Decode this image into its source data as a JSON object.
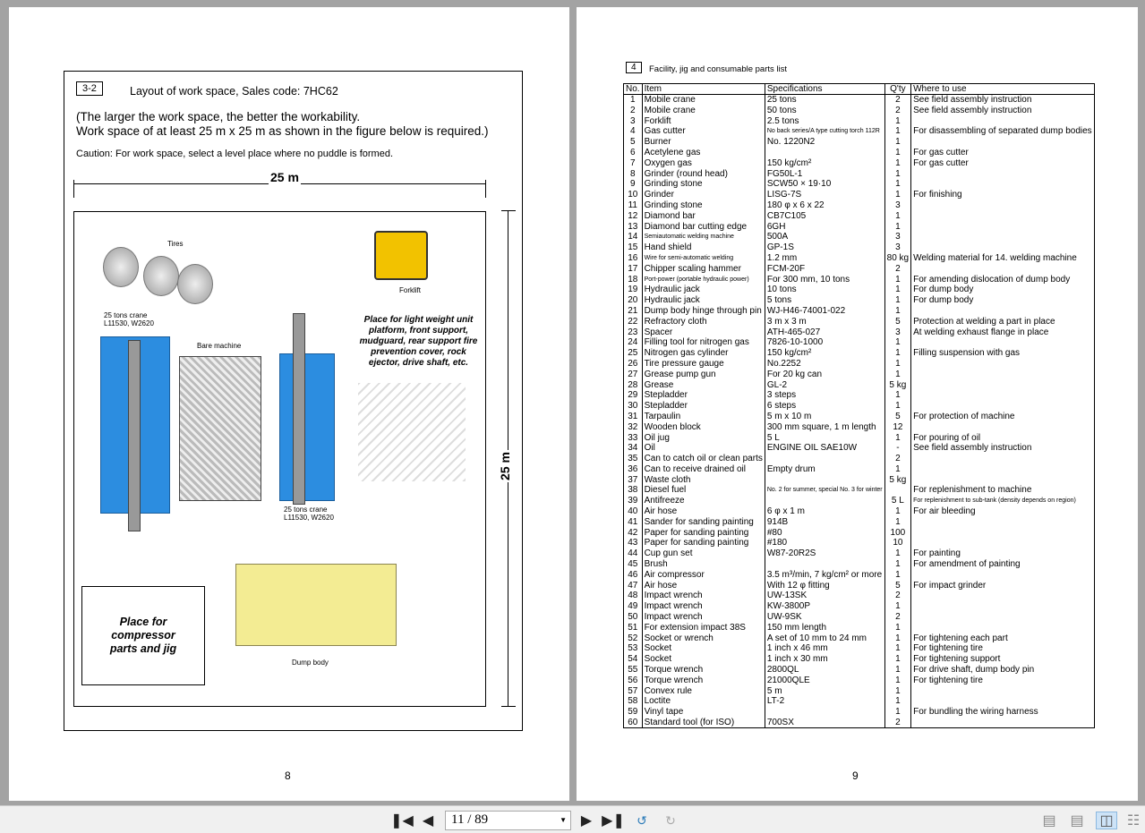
{
  "left_page": {
    "section_no": "3-2",
    "section_title": "Layout of work space, Sales code: 7HC62",
    "intro_1": "(The larger the work space, the better the workability.",
    "intro_2": "Work space of at least 25 m x 25 m as shown in the figure below is required.)",
    "caution": "Caution: For work space, select a level place where no puddle is formed.",
    "dim_horizontal": "25 m",
    "dim_vertical": "25 m",
    "labels": {
      "tires": "Tires",
      "forklift": "Forklift",
      "crane_left": "25 tons crane\nL11530, W2620",
      "bare_machine": "Bare machine",
      "crane_right": "25 tons crane\nL11530, W2620",
      "light_parts": "Place for light weight unit platform, front support, mudguard, rear support fire prevention cover, rock ejector, drive shaft, etc.",
      "compressor": "Place for compressor parts and jig",
      "dump_body": "Dump body"
    },
    "page_number": "8"
  },
  "right_page": {
    "section_no": "4",
    "section_title": "Facility, jig and consumable parts list",
    "headers": [
      "No.",
      "Item",
      "Specifications",
      "Q'ty",
      "Where to use"
    ],
    "rows": [
      [
        "1",
        "Mobile crane",
        "25 tons",
        "2",
        "See field assembly instruction"
      ],
      [
        "2",
        "Mobile crane",
        "50 tons",
        "2",
        "See field assembly instruction"
      ],
      [
        "3",
        "Forklift",
        "2.5 tons",
        "1",
        ""
      ],
      [
        "4",
        "Gas cutter",
        "No back series/A type cutting torch 112R",
        "1",
        "For disassembling of separated dump bodies"
      ],
      [
        "5",
        "Burner",
        "No. 1220N2",
        "1",
        ""
      ],
      [
        "6",
        "Acetylene gas",
        "",
        "1",
        "For gas cutter"
      ],
      [
        "7",
        "Oxygen gas",
        "150 kg/cm²",
        "1",
        "For gas cutter"
      ],
      [
        "8",
        "Grinder (round head)",
        "FG50L-1",
        "1",
        ""
      ],
      [
        "9",
        "Grinding stone",
        "SCW50 × 19·10",
        "1",
        ""
      ],
      [
        "10",
        "Grinder",
        "LISG-7S",
        "1",
        "For finishing"
      ],
      [
        "11",
        "Grinding stone",
        "180 φ x 6 x 22",
        "3",
        ""
      ],
      [
        "12",
        "Diamond bar",
        "CB7C105",
        "1",
        ""
      ],
      [
        "13",
        "Diamond bar cutting edge",
        "6GH",
        "1",
        ""
      ],
      [
        "14",
        "Semiautomatic welding machine",
        "500A",
        "3",
        ""
      ],
      [
        "15",
        "Hand shield",
        "GP-1S",
        "3",
        ""
      ],
      [
        "16",
        "Wire for semi-automatic welding",
        "1.2 mm",
        "80 kg",
        "Welding material for 14. welding machine"
      ],
      [
        "17",
        "Chipper scaling hammer",
        "FCM-20F",
        "2",
        ""
      ],
      [
        "18",
        "Port-power (portable hydraulic power)",
        "For 300 mm, 10 tons",
        "1",
        "For amending dislocation of dump body"
      ],
      [
        "19",
        "Hydraulic jack",
        "10 tons",
        "1",
        "For dump body"
      ],
      [
        "20",
        "Hydraulic jack",
        "5 tons",
        "1",
        "For dump body"
      ],
      [
        "21",
        "Dump body hinge through pin",
        "WJ-H46-74001-022",
        "1",
        ""
      ],
      [
        "22",
        "Refractory cloth",
        "3 m x 3 m",
        "5",
        "Protection at welding a part in place"
      ],
      [
        "23",
        "Spacer",
        "ATH-465-027",
        "3",
        "At welding exhaust flange in place"
      ],
      [
        "24",
        "Filling tool for nitrogen gas",
        "7826-10-1000",
        "1",
        ""
      ],
      [
        "25",
        "Nitrogen gas cylinder",
        "150 kg/cm²",
        "1",
        "Filling suspension with gas"
      ],
      [
        "26",
        "Tire pressure gauge",
        "No.2252",
        "1",
        ""
      ],
      [
        "27",
        "Grease pump gun",
        "For 20 kg can",
        "1",
        ""
      ],
      [
        "28",
        "Grease",
        "GL-2",
        "5 kg",
        ""
      ],
      [
        "29",
        "Stepladder",
        "3 steps",
        "1",
        ""
      ],
      [
        "30",
        "Stepladder",
        "6 steps",
        "1",
        ""
      ],
      [
        "31",
        "Tarpaulin",
        "5 m x 10 m",
        "5",
        "For protection of machine"
      ],
      [
        "32",
        "Wooden block",
        "300 mm square, 1 m length",
        "12",
        ""
      ],
      [
        "33",
        "Oil jug",
        "5 L",
        "1",
        "For pouring of oil"
      ],
      [
        "34",
        "Oil",
        "ENGINE OIL SAE10W",
        "-",
        "See field assembly instruction"
      ],
      [
        "35",
        "Can to catch oil or clean parts",
        "",
        "2",
        ""
      ],
      [
        "36",
        "Can to receive drained oil",
        "Empty drum",
        "1",
        ""
      ],
      [
        "37",
        "Waste cloth",
        "",
        "5 kg",
        ""
      ],
      [
        "38",
        "Diesel fuel",
        "No. 2 for summer, special No. 3 for winter",
        "",
        "For replenishment to machine"
      ],
      [
        "39",
        "Antifreeze",
        "",
        "5 L",
        "For replenishment to sub-tank (density depends on region)"
      ],
      [
        "40",
        "Air hose",
        "6 φ x 1 m",
        "1",
        "For air bleeding"
      ],
      [
        "41",
        "Sander for sanding painting",
        "914B",
        "1",
        ""
      ],
      [
        "42",
        "Paper for sanding painting",
        "#80",
        "100",
        ""
      ],
      [
        "43",
        "Paper for sanding painting",
        "#180",
        "10",
        ""
      ],
      [
        "44",
        "Cup gun set",
        "W87-20R2S",
        "1",
        "For painting"
      ],
      [
        "45",
        "Brush",
        "",
        "1",
        "For amendment of painting"
      ],
      [
        "46",
        "Air compressor",
        "3.5 m³/min, 7 kg/cm² or more",
        "1",
        ""
      ],
      [
        "47",
        "Air hose",
        "With 12 φ fitting",
        "5",
        "For impact grinder"
      ],
      [
        "48",
        "Impact wrench",
        "UW-13SK",
        "2",
        ""
      ],
      [
        "49",
        "Impact wrench",
        "KW-3800P",
        "1",
        ""
      ],
      [
        "50",
        "Impact wrench",
        "UW-9SK",
        "2",
        ""
      ],
      [
        "51",
        "For extension impact 38S",
        "150 mm length",
        "1",
        ""
      ],
      [
        "52",
        "Socket or wrench",
        "A set of 10 mm to 24 mm",
        "1",
        "For tightening each part"
      ],
      [
        "53",
        "Socket",
        "1 inch x 46 mm",
        "1",
        "For tightening tire"
      ],
      [
        "54",
        "Socket",
        "1 inch x 30 mm",
        "1",
        "For tightening support"
      ],
      [
        "55",
        "Torque wrench",
        "2800QL",
        "1",
        "For drive shaft, dump body pin"
      ],
      [
        "56",
        "Torque wrench",
        "21000QLE",
        "1",
        "For tightening tire"
      ],
      [
        "57",
        "Convex rule",
        "5 m",
        "1",
        ""
      ],
      [
        "58",
        "Loctite",
        "LT-2",
        "1",
        ""
      ],
      [
        "59",
        "Vinyl tape",
        "",
        "1",
        "For bundling the wiring harness"
      ],
      [
        "60",
        "Standard tool (for ISO)",
        "700SX",
        "2",
        ""
      ]
    ],
    "page_number": "9"
  },
  "toolbar": {
    "page_field": "11 / 89",
    "buttons": [
      "first-page",
      "previous-page",
      "next-page",
      "last-page",
      "rotate-cw",
      "rotate-ccw",
      "single-page",
      "continuous",
      "two-page",
      "two-page-continuous"
    ]
  },
  "colors": {
    "crane_blue": "#2c8de0",
    "dump_yellow": "#f3ec93",
    "forklift_yellow": "#f2c200"
  }
}
